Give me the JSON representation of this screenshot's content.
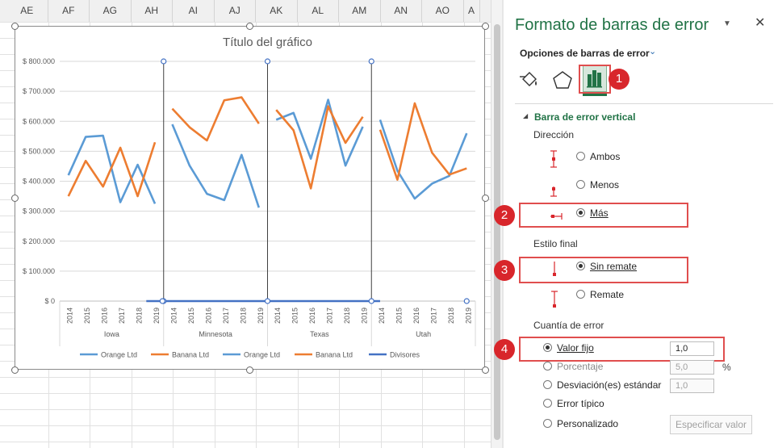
{
  "spreadsheet": {
    "columns": [
      "AE",
      "AF",
      "AG",
      "AH",
      "AI",
      "AJ",
      "AK",
      "AL",
      "AM",
      "AN",
      "AO",
      "A"
    ]
  },
  "chart_data": {
    "type": "line",
    "title": "Título del gráfico",
    "yticks": [
      "$ 0",
      "$ 100.000",
      "$ 200.000",
      "$ 300.000",
      "$ 400.000",
      "$ 500.000",
      "$ 600.000",
      "$ 700.000",
      "$ 800.000"
    ],
    "ylim": [
      0,
      800000
    ],
    "groups": [
      {
        "name": "Iowa",
        "years": [
          "2014",
          "2015",
          "2016",
          "2017",
          "2018",
          "2019"
        ],
        "orange_ltd": [
          420000,
          548000,
          552000,
          330000,
          455000,
          325000
        ],
        "banana_ltd": [
          350000,
          468000,
          382000,
          512000,
          350000,
          530000
        ]
      },
      {
        "name": "Minnesota",
        "years": [
          "2014",
          "2015",
          "2016",
          "2017",
          "2018",
          "2019"
        ],
        "orange_ltd": [
          590000,
          452000,
          358000,
          337000,
          488000,
          312000
        ],
        "banana_ltd": [
          642000,
          580000,
          536000,
          670000,
          680000,
          592000
        ]
      },
      {
        "name": "Texas",
        "years": [
          "2014",
          "2015",
          "2016",
          "2017",
          "2018",
          "2019"
        ],
        "orange_ltd": [
          605000,
          628000,
          475000,
          672000,
          452000,
          582000
        ],
        "banana_ltd": [
          638000,
          570000,
          376000,
          650000,
          528000,
          615000
        ]
      },
      {
        "name": "Utah",
        "years": [
          "2014",
          "2015",
          "2016",
          "2017",
          "2018",
          "2019"
        ],
        "orange_ltd": [
          605000,
          435000,
          342000,
          392000,
          418000,
          560000
        ],
        "banana_ltd": [
          572000,
          405000,
          660000,
          495000,
          422000,
          443000
        ]
      }
    ],
    "legend": [
      "Orange Ltd",
      "Banana Ltd",
      "Orange Ltd",
      "Banana Ltd",
      "Divisores"
    ],
    "colors": {
      "orange_ltd": "#5b9bd5",
      "banana_ltd": "#ed7d31",
      "divisores": "#4472c4",
      "divider_line": "#404040"
    },
    "dividers": [
      "Iowa|Minnesota",
      "Minnesota|Texas",
      "Texas|Utah"
    ]
  },
  "panel": {
    "title": "Formato de barras de error",
    "options_label": "Opciones de barras de error",
    "section_title": "Barra de error vertical",
    "direccion_label": "Dirección",
    "direccion": [
      {
        "label": "Ambos",
        "selected": false
      },
      {
        "label": "Menos",
        "selected": false
      },
      {
        "label": "Más",
        "selected": true
      }
    ],
    "estilo_label": "Estilo final",
    "estilo": [
      {
        "label": "Sin remate",
        "selected": true
      },
      {
        "label": "Remate",
        "selected": false
      }
    ],
    "cuantia_label": "Cuantía de error",
    "cuantia": [
      {
        "label": "Valor fijo",
        "selected": true,
        "value": "1,0"
      },
      {
        "label": "Porcentaje",
        "selected": false,
        "value": "5,0",
        "unit": "%"
      },
      {
        "label": "Desviación(es) estándar",
        "selected": false,
        "value": "1,0"
      },
      {
        "label": "Error típico",
        "selected": false
      },
      {
        "label": "Personalizado",
        "selected": false
      }
    ],
    "especificar_label": "Especificar valor",
    "badges": [
      "1",
      "2",
      "3",
      "4"
    ],
    "accent": "#217346",
    "callout_color": "#e04e4e"
  }
}
